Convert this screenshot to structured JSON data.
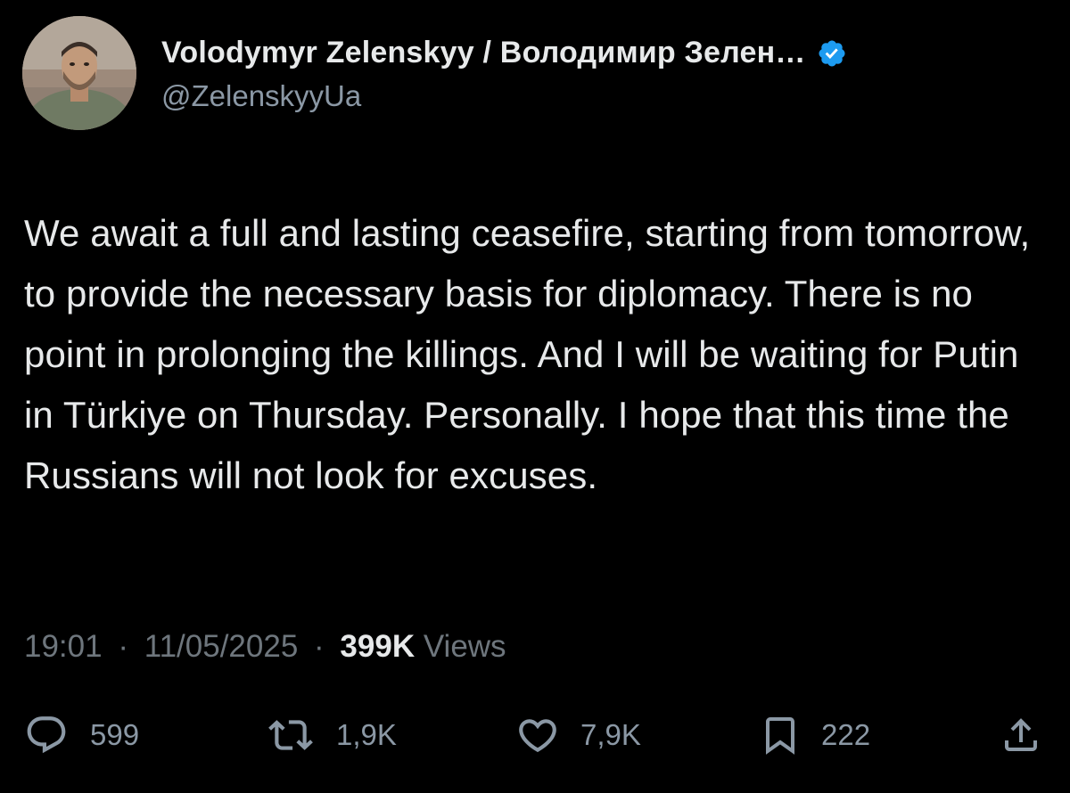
{
  "author": {
    "display_name": "Volodymyr Zelenskyy / Володимир Зелен…",
    "handle": "@ZelenskyyUa",
    "verified_icon": "verified-badge-icon",
    "verified_color": "#1d9bf0"
  },
  "tweet": {
    "text": "We await a full and lasting ceasefire, starting from tomorrow, to provide the necessary basis for diplomacy. There is no point in prolonging the killings. And I will be waiting for Putin in Türkiye on Thursday. Personally. I hope that this time the Russians will not look for excuses.",
    "time": "19:01",
    "separator": "·",
    "date": "11/05/2025",
    "views_count": "399K",
    "views_label": "Views"
  },
  "actions": {
    "reply": {
      "icon": "reply-icon",
      "count": "599"
    },
    "retweet": {
      "icon": "retweet-icon",
      "count": "1,9K"
    },
    "like": {
      "icon": "heart-icon",
      "count": "7,9K"
    },
    "bookmark": {
      "icon": "bookmark-icon",
      "count": "222"
    },
    "share": {
      "icon": "share-icon"
    }
  },
  "colors": {
    "background": "#000000",
    "text_primary": "#e7e9ea",
    "text_secondary": "#8b98a5",
    "meta_text": "#6e767d"
  }
}
